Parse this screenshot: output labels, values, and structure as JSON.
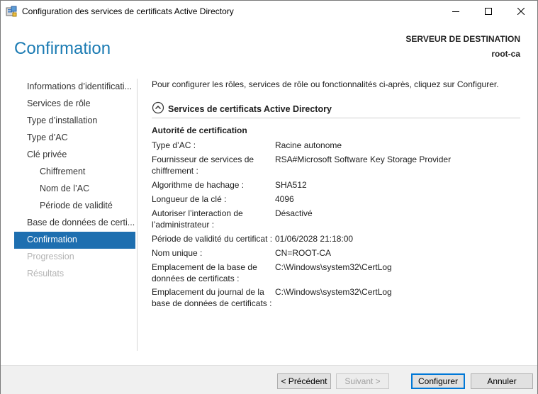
{
  "window": {
    "title": "Configuration des services de certificats Active Directory"
  },
  "header": {
    "page_title": "Confirmation",
    "destination_label": "SERVEUR DE DESTINATION",
    "destination_server": "root-ca"
  },
  "nav": {
    "items": [
      {
        "label": "Informations d’identificati...",
        "level": 0,
        "state": "normal"
      },
      {
        "label": "Services de rôle",
        "level": 0,
        "state": "normal"
      },
      {
        "label": "Type d’installation",
        "level": 0,
        "state": "normal"
      },
      {
        "label": "Type d’AC",
        "level": 0,
        "state": "normal"
      },
      {
        "label": "Clé privée",
        "level": 0,
        "state": "normal"
      },
      {
        "label": "Chiffrement",
        "level": 1,
        "state": "normal"
      },
      {
        "label": "Nom de l’AC",
        "level": 1,
        "state": "normal"
      },
      {
        "label": "Période de validité",
        "level": 1,
        "state": "normal"
      },
      {
        "label": "Base de données de certi...",
        "level": 0,
        "state": "normal"
      },
      {
        "label": "Confirmation",
        "level": 0,
        "state": "active"
      },
      {
        "label": "Progression",
        "level": 0,
        "state": "disabled"
      },
      {
        "label": "Résultats",
        "level": 0,
        "state": "disabled"
      }
    ]
  },
  "content": {
    "intro": "Pour configurer les rôles, services de rôle ou fonctionnalités ci-après, cliquez sur Configurer.",
    "section_title": "Services de certificats Active Directory",
    "group_title": "Autorité de certification",
    "properties": [
      {
        "key": "Type d’AC :",
        "value": "Racine autonome"
      },
      {
        "key": "Fournisseur de services de chiffrement :",
        "value": "RSA#Microsoft Software Key Storage Provider"
      },
      {
        "key": "Algorithme de hachage :",
        "value": "SHA512"
      },
      {
        "key": "Longueur de la clé :",
        "value": "4096"
      },
      {
        "key": "Autoriser l’interaction de l’administrateur :",
        "value": "Désactivé"
      },
      {
        "key": "Période de validité du certificat :",
        "value": "01/06/2028 21:18:00"
      },
      {
        "key": "Nom unique :",
        "value": "CN=ROOT-CA"
      },
      {
        "key": "Emplacement de la base de données de certificats :",
        "value": "C:\\Windows\\system32\\CertLog"
      },
      {
        "key": "Emplacement du journal de la base de données de certificats :",
        "value": "C:\\Windows\\system32\\CertLog"
      }
    ]
  },
  "footer": {
    "previous_label": "< Précédent",
    "next_label": "Suivant >",
    "configure_label": "Configurer",
    "cancel_label": "Annuler"
  },
  "icons": {
    "app": "server-manager-icon",
    "minimize": "minimize-icon",
    "maximize": "maximize-icon",
    "close": "close-icon",
    "collapse": "chevron-up-circle-icon"
  },
  "colors": {
    "accent": "#1e6fb0",
    "title_blue": "#1b7bb3"
  }
}
